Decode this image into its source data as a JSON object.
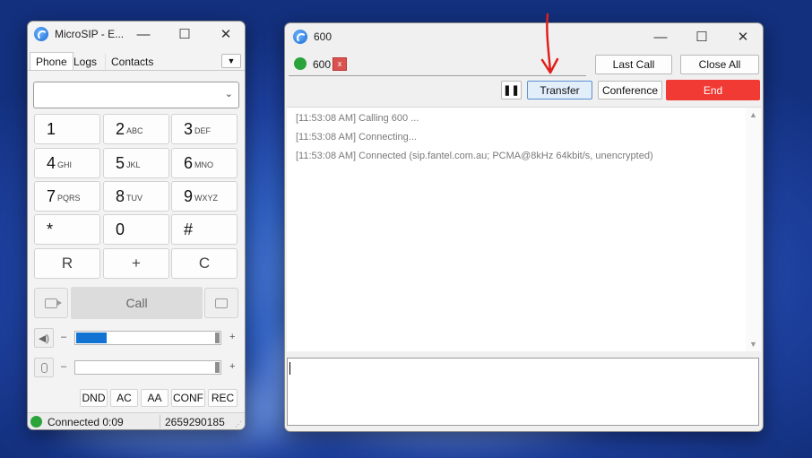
{
  "phone": {
    "title": "MicroSIP - E...",
    "tabs": [
      "Phone",
      "Logs",
      "Contacts"
    ],
    "dropdown_value": "",
    "keys": [
      {
        "num": "1",
        "letters": ""
      },
      {
        "num": "2",
        "letters": "ABC"
      },
      {
        "num": "3",
        "letters": "DEF"
      },
      {
        "num": "4",
        "letters": "GHI"
      },
      {
        "num": "5",
        "letters": "JKL"
      },
      {
        "num": "6",
        "letters": "MNO"
      },
      {
        "num": "7",
        "letters": "PQRS"
      },
      {
        "num": "8",
        "letters": "TUV"
      },
      {
        "num": "9",
        "letters": "WXYZ"
      },
      {
        "num": "*",
        "letters": ""
      },
      {
        "num": "0",
        "letters": ""
      },
      {
        "num": "#",
        "letters": ""
      }
    ],
    "controls": [
      "R",
      "+",
      "C"
    ],
    "call_label": "Call",
    "speaker_level": 0.22,
    "mic_level": 0.0,
    "minus": "–",
    "plus": "+",
    "feature_buttons": [
      "DND",
      "AC",
      "AA",
      "CONF",
      "REC"
    ],
    "status_text": "Connected 0:09",
    "account_number": "2659290185",
    "colors": {
      "level_fill": "#1373d3",
      "status_green": "#2aa33b"
    }
  },
  "call": {
    "title": "600",
    "call_tab_label": "600",
    "buttons": {
      "last_call": "Last Call",
      "close_all": "Close All",
      "transfer": "Transfer",
      "conference": "Conference",
      "end": "End"
    },
    "log": [
      "[11:53:08 AM]  Calling 600 ...",
      "[11:53:08 AM]  Connecting...",
      "[11:53:08 AM]  Connected (sip.fantel.com.au; PCMA@8kHz 64kbit/s, unencrypted)"
    ],
    "message_input": "",
    "colors": {
      "end_button": "#f03a33",
      "transfer_highlight": "#e3eefb",
      "annotation_arrow": "#e0201c"
    }
  }
}
